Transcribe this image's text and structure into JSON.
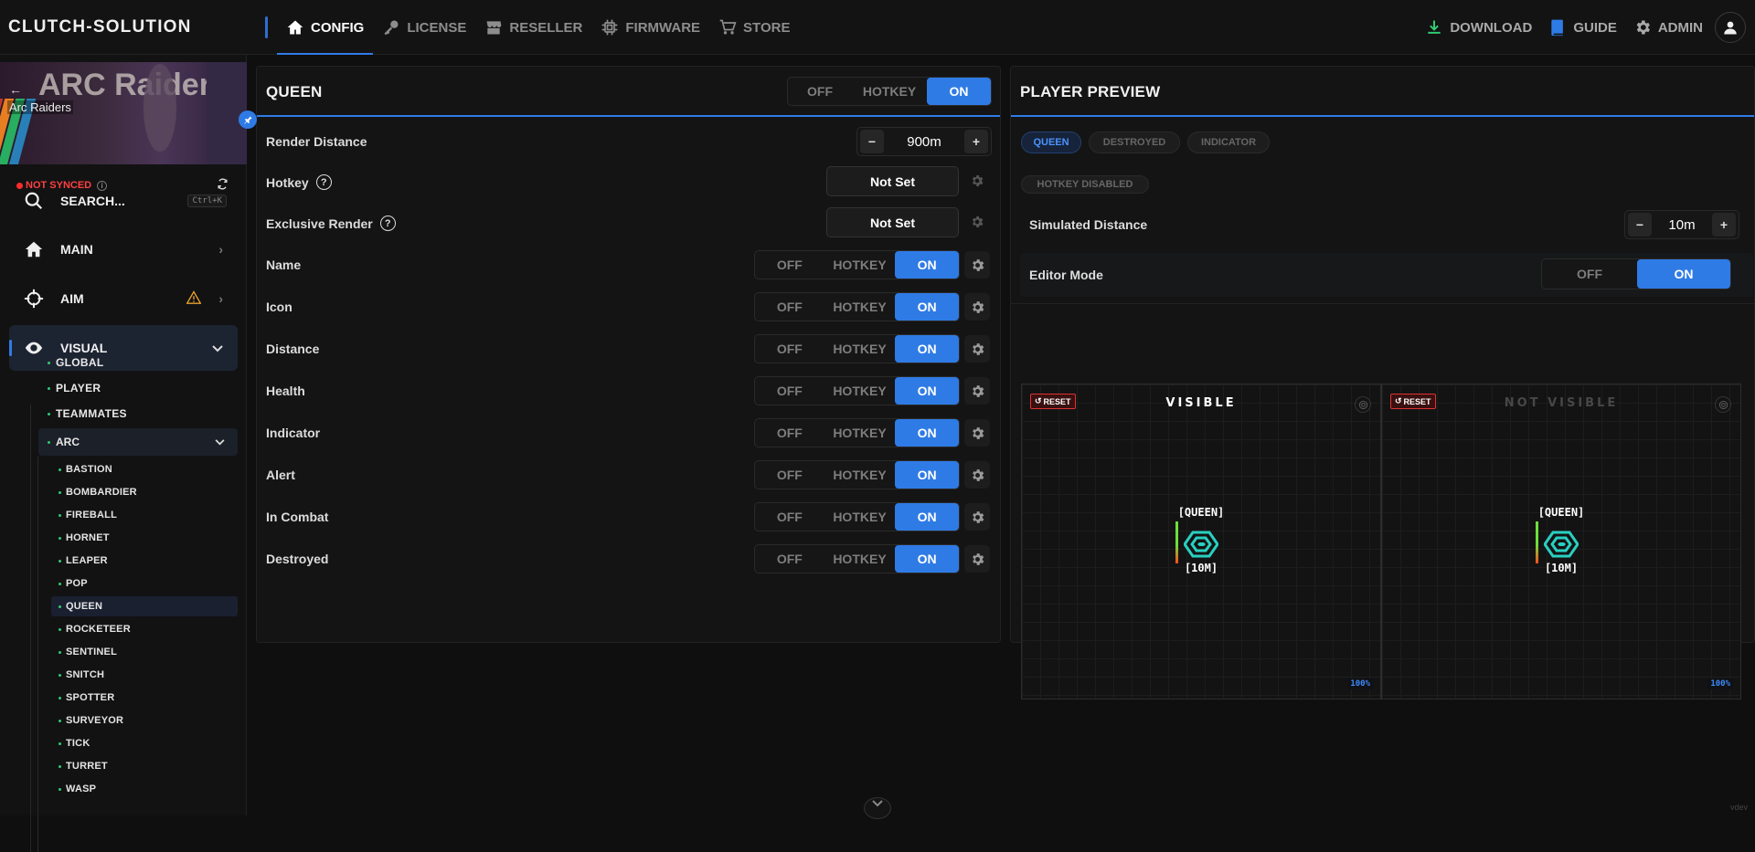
{
  "app": {
    "brand": "CLUTCH-SOLUTION"
  },
  "nav": {
    "left": [
      {
        "label": "CONFIG",
        "icon": "home-icon",
        "active": true
      },
      {
        "label": "LICENSE",
        "icon": "key-icon"
      },
      {
        "label": "RESELLER",
        "icon": "store-front-icon"
      },
      {
        "label": "FIRMWARE",
        "icon": "chip-icon"
      },
      {
        "label": "STORE",
        "icon": "cart-icon"
      }
    ],
    "right": [
      {
        "label": "DOWNLOAD",
        "icon": "download-icon",
        "color": "#2ecc71"
      },
      {
        "label": "GUIDE",
        "icon": "book-icon",
        "color": "#2f7be6"
      },
      {
        "label": "ADMIN",
        "icon": "gear-icon",
        "color": "#a9a9a9"
      }
    ]
  },
  "sidebar": {
    "game_title": "Arc Raiders",
    "banner_art_text": "ARC Raiders",
    "sync_status": "NOT SYNCED",
    "search": {
      "label": "SEARCH...",
      "shortcut": "Ctrl+K"
    },
    "items": [
      {
        "label": "MAIN",
        "icon": "home-icon"
      },
      {
        "label": "AIM",
        "icon": "crosshair-icon",
        "warning": true
      },
      {
        "label": "VISUAL",
        "icon": "eye-icon",
        "open": true
      }
    ],
    "visual_children": [
      "GLOBAL",
      "PLAYER",
      "TEAMMATES"
    ],
    "arc_label": "ARC",
    "arc_children": [
      "BASTION",
      "BOMBARDIER",
      "FIREBALL",
      "HORNET",
      "LEAPER",
      "POP",
      "QUEEN",
      "ROCKETEER",
      "SENTINEL",
      "SNITCH",
      "SPOTTER",
      "SURVEYOR",
      "TICK",
      "TURRET",
      "WASP"
    ],
    "arc_selected": "QUEEN"
  },
  "config": {
    "title": "QUEEN",
    "master_toggle": {
      "options": [
        "OFF",
        "HOTKEY",
        "ON"
      ],
      "selected": "ON"
    },
    "render_distance": {
      "label": "Render Distance",
      "value": "900m",
      "minus": "−",
      "plus": "+"
    },
    "hotkey": {
      "label": "Hotkey",
      "value": "Not Set"
    },
    "exclusive_render": {
      "label": "Exclusive Render",
      "value": "Not Set"
    },
    "rows": [
      {
        "label": "Name",
        "selected": "ON"
      },
      {
        "label": "Icon",
        "selected": "ON"
      },
      {
        "label": "Distance",
        "selected": "ON"
      },
      {
        "label": "Health",
        "selected": "ON"
      },
      {
        "label": "Indicator",
        "selected": "ON"
      },
      {
        "label": "Alert",
        "selected": "ON"
      },
      {
        "label": "In Combat",
        "selected": "ON"
      },
      {
        "label": "Destroyed",
        "selected": "ON"
      }
    ],
    "toggle_options": [
      "OFF",
      "HOTKEY",
      "ON"
    ]
  },
  "preview": {
    "title": "PLAYER PREVIEW",
    "tabs": [
      "QUEEN",
      "DESTROYED",
      "INDICATOR"
    ],
    "tab_selected": "QUEEN",
    "hotkey_badge": "HOTKEY DISABLED",
    "simulated_distance": {
      "label": "Simulated Distance",
      "value": "10m",
      "minus": "−",
      "plus": "+"
    },
    "editor_mode": {
      "label": "Editor Mode",
      "options": [
        "OFF",
        "ON"
      ],
      "selected": "ON"
    },
    "canvases": [
      {
        "title": "VISIBLE",
        "reset": "RESET",
        "entity_name": "[QUEEN]",
        "entity_distance": "[10M]",
        "zoom": "100%",
        "dim": false
      },
      {
        "title": "NOT VISIBLE",
        "reset": "RESET",
        "entity_name": "[QUEEN]",
        "entity_distance": "[10M]",
        "zoom": "100%",
        "dim": true
      }
    ],
    "health_fraction": 0.6
  },
  "footer": {
    "version": "vdev"
  },
  "colors": {
    "accent": "#2f7be6",
    "danger": "#ff2b2b",
    "ok": "#2ecc71",
    "warning": "#e8a22a",
    "entity": "#28d0c0"
  }
}
